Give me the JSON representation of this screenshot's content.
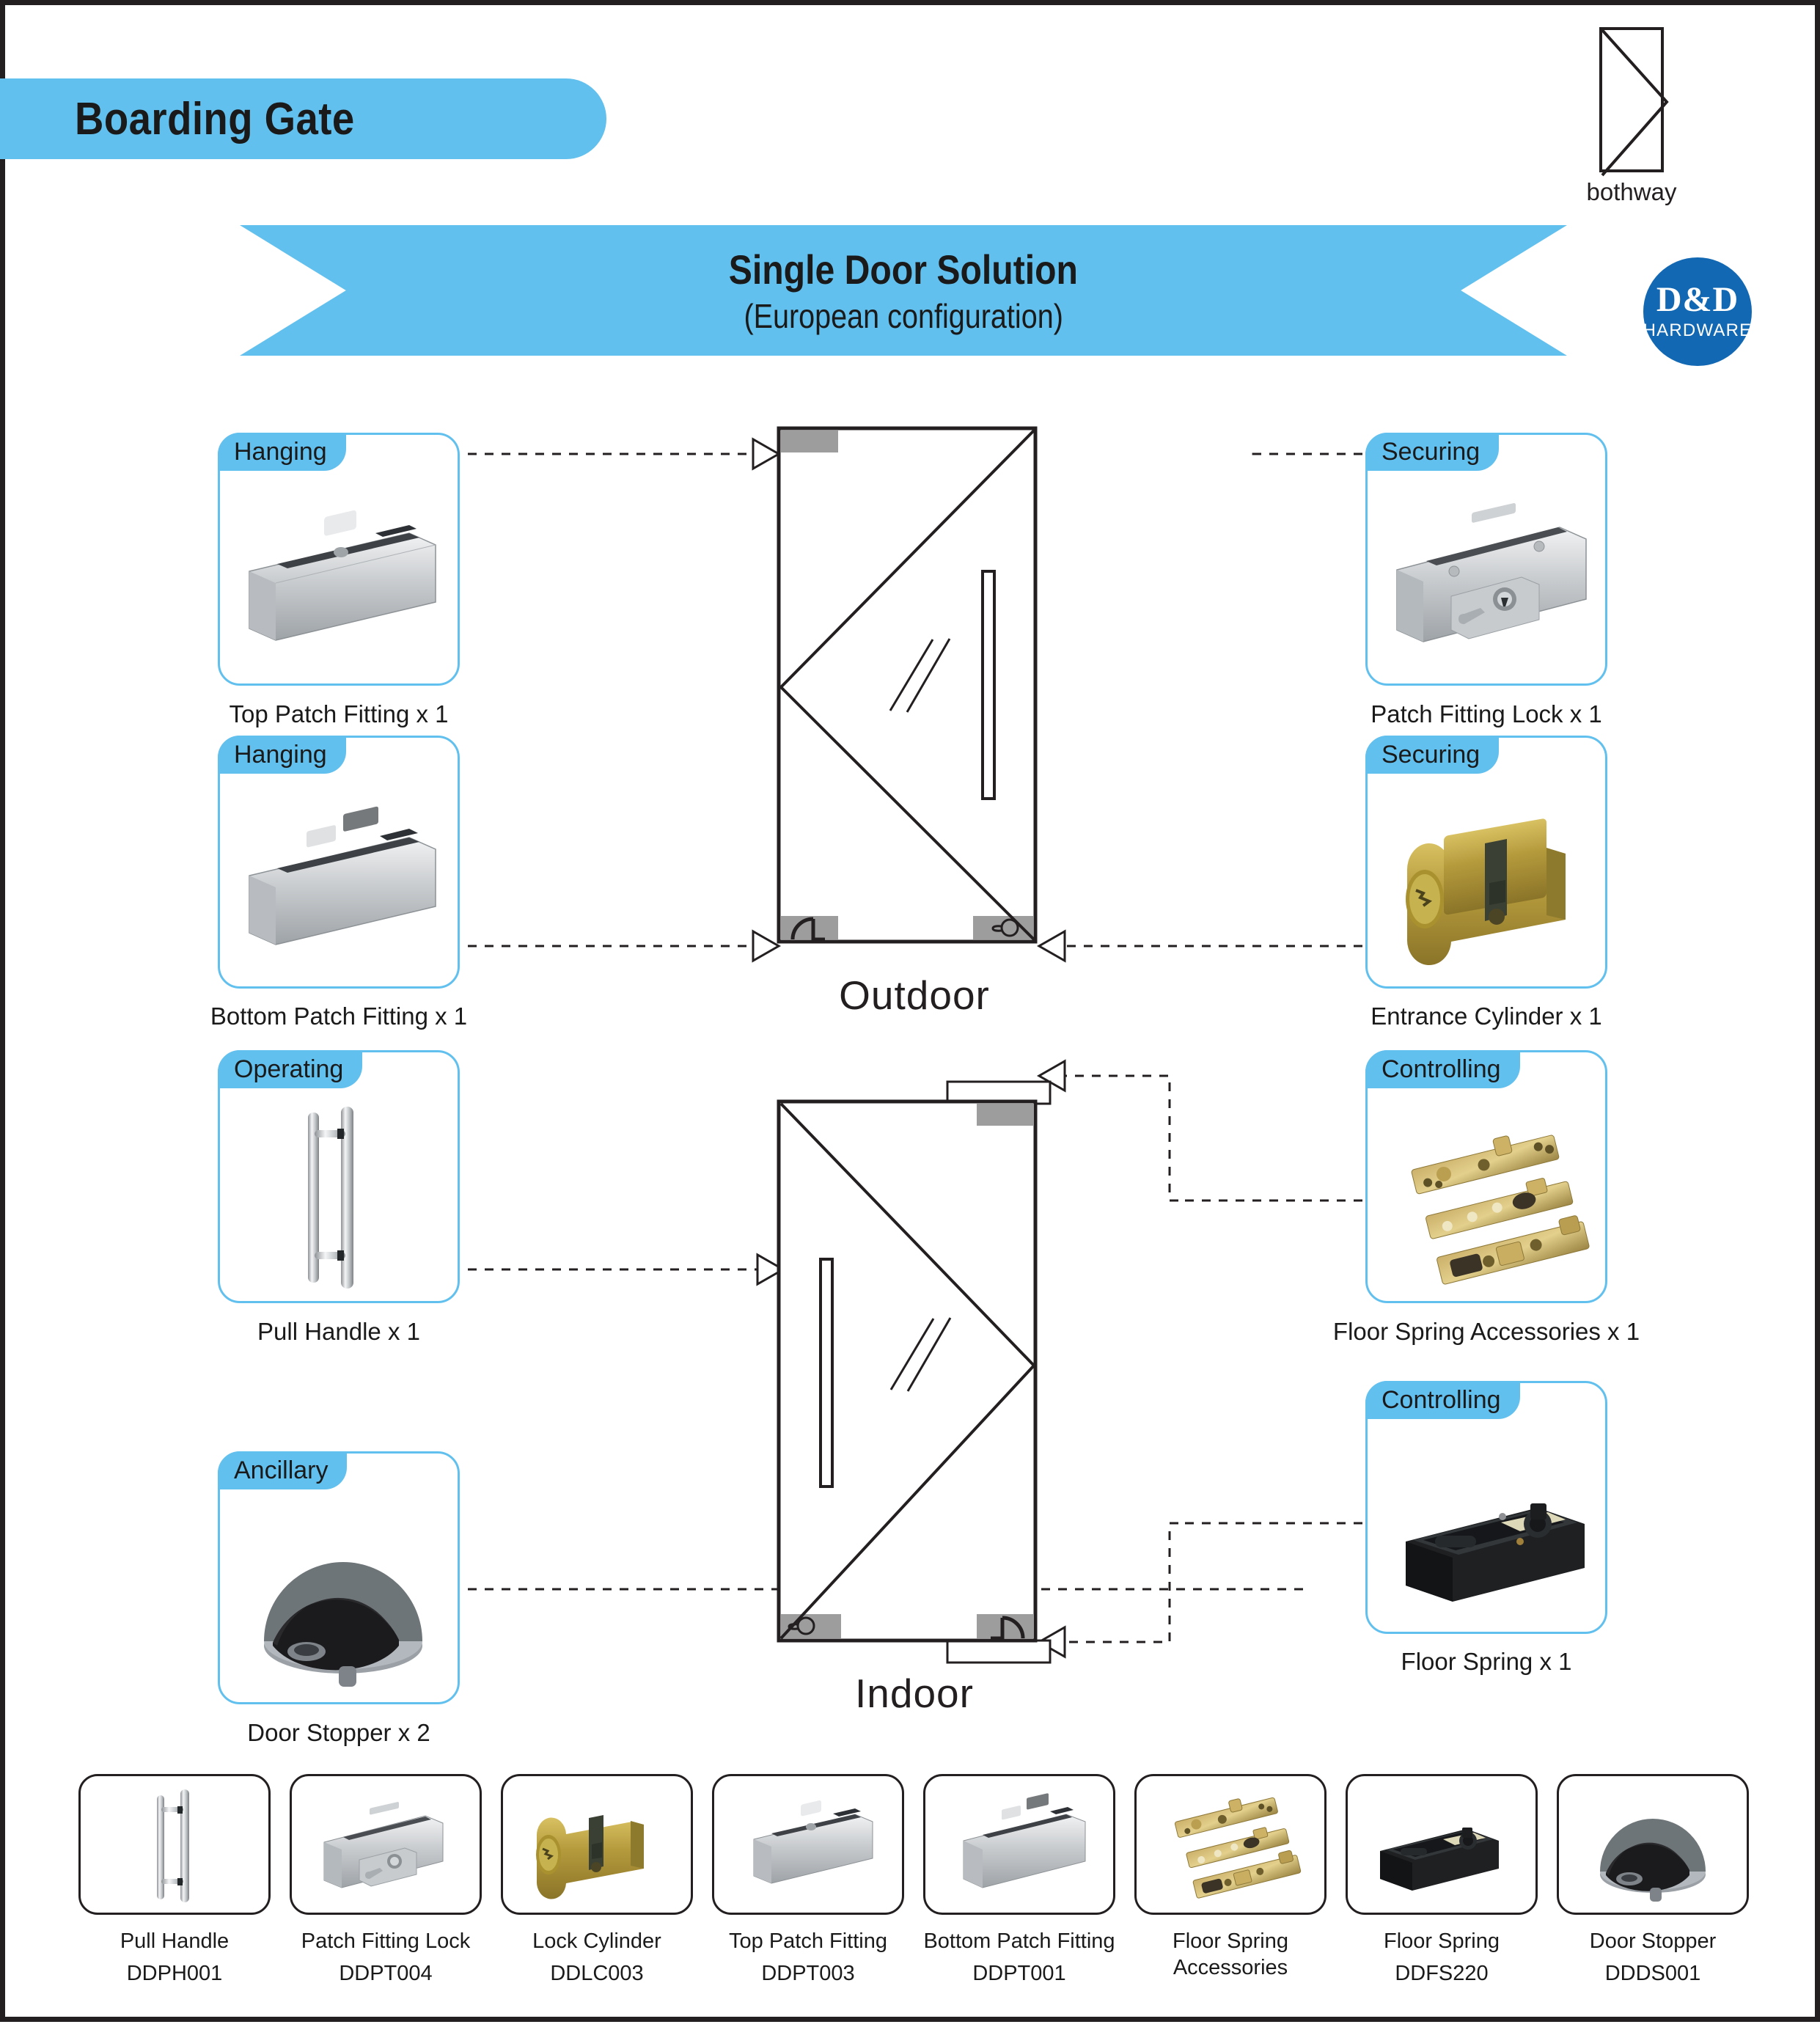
{
  "header": {
    "title": "Boarding Gate",
    "brand_mark": "bothway-logo",
    "brand_caption": "bothway",
    "logo_line1": "D&D",
    "logo_line2": "HARDWARE",
    "accent_blue": "#62c0ee",
    "logo_blue": "#1268b3"
  },
  "ribbon": {
    "title": "Single Door Solution",
    "subtitle": "(European configuration)"
  },
  "doors": {
    "outdoor_label": "Outdoor",
    "indoor_label": "Indoor"
  },
  "cards": [
    {
      "tag": "Hanging",
      "caption": "Top Patch Fitting x 1",
      "icon": "top-patch-fitting-photo"
    },
    {
      "tag": "Hanging",
      "caption": "Bottom Patch Fitting x 1",
      "icon": "bottom-patch-fitting-photo"
    },
    {
      "tag": "Operating",
      "caption": "Pull Handle x 1",
      "icon": "pull-handle-photo"
    },
    {
      "tag": "Ancillary",
      "caption": "Door Stopper x 2",
      "icon": "door-stopper-photo"
    },
    {
      "tag": "Securing",
      "caption": "Patch Fitting Lock x 1",
      "icon": "patch-fitting-lock-photo"
    },
    {
      "tag": "Securing",
      "caption": "Entrance Cylinder x 1",
      "icon": "entrance-cylinder-photo"
    },
    {
      "tag": "Controlling",
      "caption": "Floor Spring Accessories x 1",
      "icon": "floor-spring-accessories-photo"
    },
    {
      "tag": "Controlling",
      "caption": "Floor Spring x 1",
      "icon": "floor-spring-photo"
    }
  ],
  "strip": [
    {
      "name": "Pull Handle",
      "code": "DDPH001",
      "icon": "pull-handle-photo"
    },
    {
      "name": "Patch Fitting Lock",
      "code": "DDPT004",
      "icon": "patch-fitting-lock-photo"
    },
    {
      "name": "Lock Cylinder",
      "code": "DDLC003",
      "icon": "lock-cylinder-photo"
    },
    {
      "name": "Top Patch Fitting",
      "code": "DDPT003",
      "icon": "top-patch-fitting-photo"
    },
    {
      "name": "Bottom Patch Fitting",
      "code": "DDPT001",
      "icon": "bottom-patch-fitting-photo"
    },
    {
      "name": "Floor Spring Accessories",
      "code": "",
      "icon": "floor-spring-accessories-photo"
    },
    {
      "name": "Floor Spring",
      "code": "DDFS220",
      "icon": "floor-spring-photo"
    },
    {
      "name": "Door Stopper",
      "code": "DDDS001",
      "icon": "door-stopper-photo"
    }
  ]
}
